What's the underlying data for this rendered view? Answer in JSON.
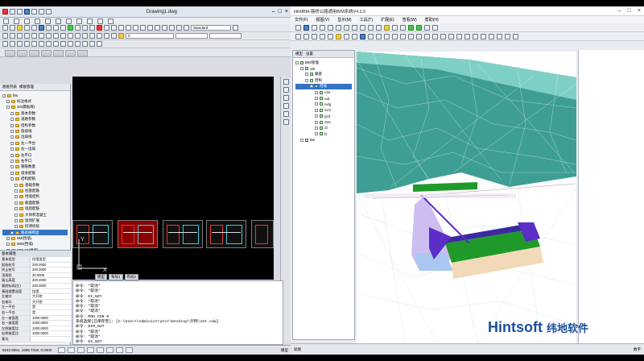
{
  "cad": {
    "title": "Drawing1.dwg",
    "workspace": "Standard",
    "layer_combo": "0",
    "panel_tabs": [
      "图纸列表",
      "模板管理"
    ],
    "tree": [
      {
        "label": "f8n",
        "depth": 0
      },
      {
        "label": "标注格式",
        "depth": 1
      },
      {
        "label": "4D(模板库)",
        "depth": 1
      },
      {
        "label": "基本参数",
        "depth": 2
      },
      {
        "label": "道路参数",
        "depth": 2
      },
      {
        "label": "结构参数",
        "depth": 2
      },
      {
        "label": "放坡线",
        "depth": 2
      },
      {
        "label": "边坡线",
        "depth": 2
      },
      {
        "label": "左一平台",
        "depth": 2
      },
      {
        "label": "左一边坡",
        "depth": 2
      },
      {
        "label": "左平口",
        "depth": 2
      },
      {
        "label": "右平口",
        "depth": 2
      },
      {
        "label": "钢筋数量",
        "depth": 2
      },
      {
        "label": "墙身配筋",
        "depth": 2
      },
      {
        "label": "结构配筋",
        "depth": 2
      },
      {
        "label": "基础参数",
        "depth": 3
      },
      {
        "label": "桩基配筋",
        "depth": 3
      },
      {
        "label": "挡墙结构",
        "depth": 3
      },
      {
        "label": "截面配筋",
        "depth": 3
      },
      {
        "label": "墙后配筋",
        "depth": 3
      },
      {
        "label": "大体积混凝土",
        "depth": 3
      },
      {
        "label": "墙顶扩展",
        "depth": 3
      },
      {
        "label": "检测校核",
        "depth": 3
      },
      {
        "label": "路基横断面",
        "depth": 2,
        "selected": true
      },
      {
        "label": "5M(挡墙)",
        "depth": 1
      },
      {
        "label": "60D(挡墙)",
        "depth": 1
      },
      {
        "label": "2D5 MI(挡墙)",
        "depth": 1
      },
      {
        "label": "4M(挡墙)",
        "depth": 1
      },
      {
        "label": "1D4 3(挡墙)",
        "depth": 1
      }
    ],
    "props_title": "基本属性",
    "props": [
      {
        "k": "基本类型",
        "v": "挡墙类型"
      },
      {
        "k": "起始桩号",
        "v": "200.0000"
      },
      {
        "k": "终止桩号",
        "v": "200.0000"
      },
      {
        "k": "顶高程",
        "v": "30.0000"
      },
      {
        "k": "填土高度",
        "v": "200.0000"
      },
      {
        "k": "基底标高(左)",
        "v": "200.0000"
      },
      {
        "k": "基础埋置深度",
        "v": "挡墙"
      },
      {
        "k": "左坡口",
        "v": "大开挖"
      },
      {
        "k": "右坡口",
        "v": "大开挖"
      },
      {
        "k": "左一平台",
        "v": "是"
      },
      {
        "k": "右一平台",
        "v": "是"
      },
      {
        "k": "左一坡面宽",
        "v": "1000.0000"
      },
      {
        "k": "右一坡面宽",
        "v": "1000.0000"
      },
      {
        "k": "左侧坡度比",
        "v": "1000.0000"
      },
      {
        "k": "右侧坡度比",
        "v": "1000.0000"
      },
      {
        "k": "基坑",
        "v": ""
      }
    ],
    "model_tabs": [
      "模型",
      "布局1",
      "布局2"
    ],
    "ucs_x": "X",
    "ucs_y": "Y",
    "cmd_lines": [
      "命令: *取消*",
      "命令: *取消*",
      "命令: EX_NZY",
      "命令: *取消*",
      "命令: *取消*",
      "命令: *取消*",
      "命令: MOD_CON 0",
      "系统选择[已保存至]: [C:\\Users\\Administrator\\Desktop\\示例\\15t.cdw]",
      "命令: BIM_OUT",
      "命令: *取消*",
      "命令: *取消*",
      "命令: EX_NZY"
    ],
    "status_coords": "9243.8651, 1999.7318, 0.0000",
    "status_right": "模型"
  },
  "bim": {
    "title": "HintBIM-路桥公路通用BIM系统V4.0.5",
    "menu": [
      "文件(F)",
      "视图(V)",
      "显示(M)",
      "工具(T)",
      "扩展(E)",
      "查看(W)",
      "帮助(H)"
    ],
    "tree_tabs": [
      "模型",
      "设置"
    ],
    "tree": [
      {
        "label": "BIM管理",
        "depth": 0
      },
      {
        "label": "15t",
        "depth": 1
      },
      {
        "label": "路基",
        "depth": 2
      },
      {
        "label": "结构",
        "depth": 2
      },
      {
        "label": "挡墙",
        "depth": 3,
        "selected": true
      },
      {
        "label": "c4e",
        "depth": 4
      },
      {
        "label": "u4t",
        "depth": 4
      },
      {
        "label": "cvtg",
        "depth": 4
      },
      {
        "label": "cvrz",
        "depth": 4
      },
      {
        "label": "pz3",
        "depth": 4
      },
      {
        "label": "zwx",
        "depth": 4
      },
      {
        "label": "zz",
        "depth": 4
      },
      {
        "label": "fz",
        "depth": 4
      },
      {
        "label": "Bsi",
        "depth": 1
      }
    ],
    "status_left": "就绪",
    "status_right": "数字"
  },
  "watermark": {
    "en": "Hintsoft",
    "cn": "纬地软件"
  },
  "colors": {
    "terrain": "#3f9e93",
    "terrain_light": "#7fd0c4",
    "accent": "#1b4f9c",
    "wall_green": "#1f9a2a",
    "wall_purple": "#5b2ec7",
    "wall_lilac": "#c9b6f0",
    "base_blue": "#a9c7f0",
    "base_tan": "#f2d9b7"
  }
}
